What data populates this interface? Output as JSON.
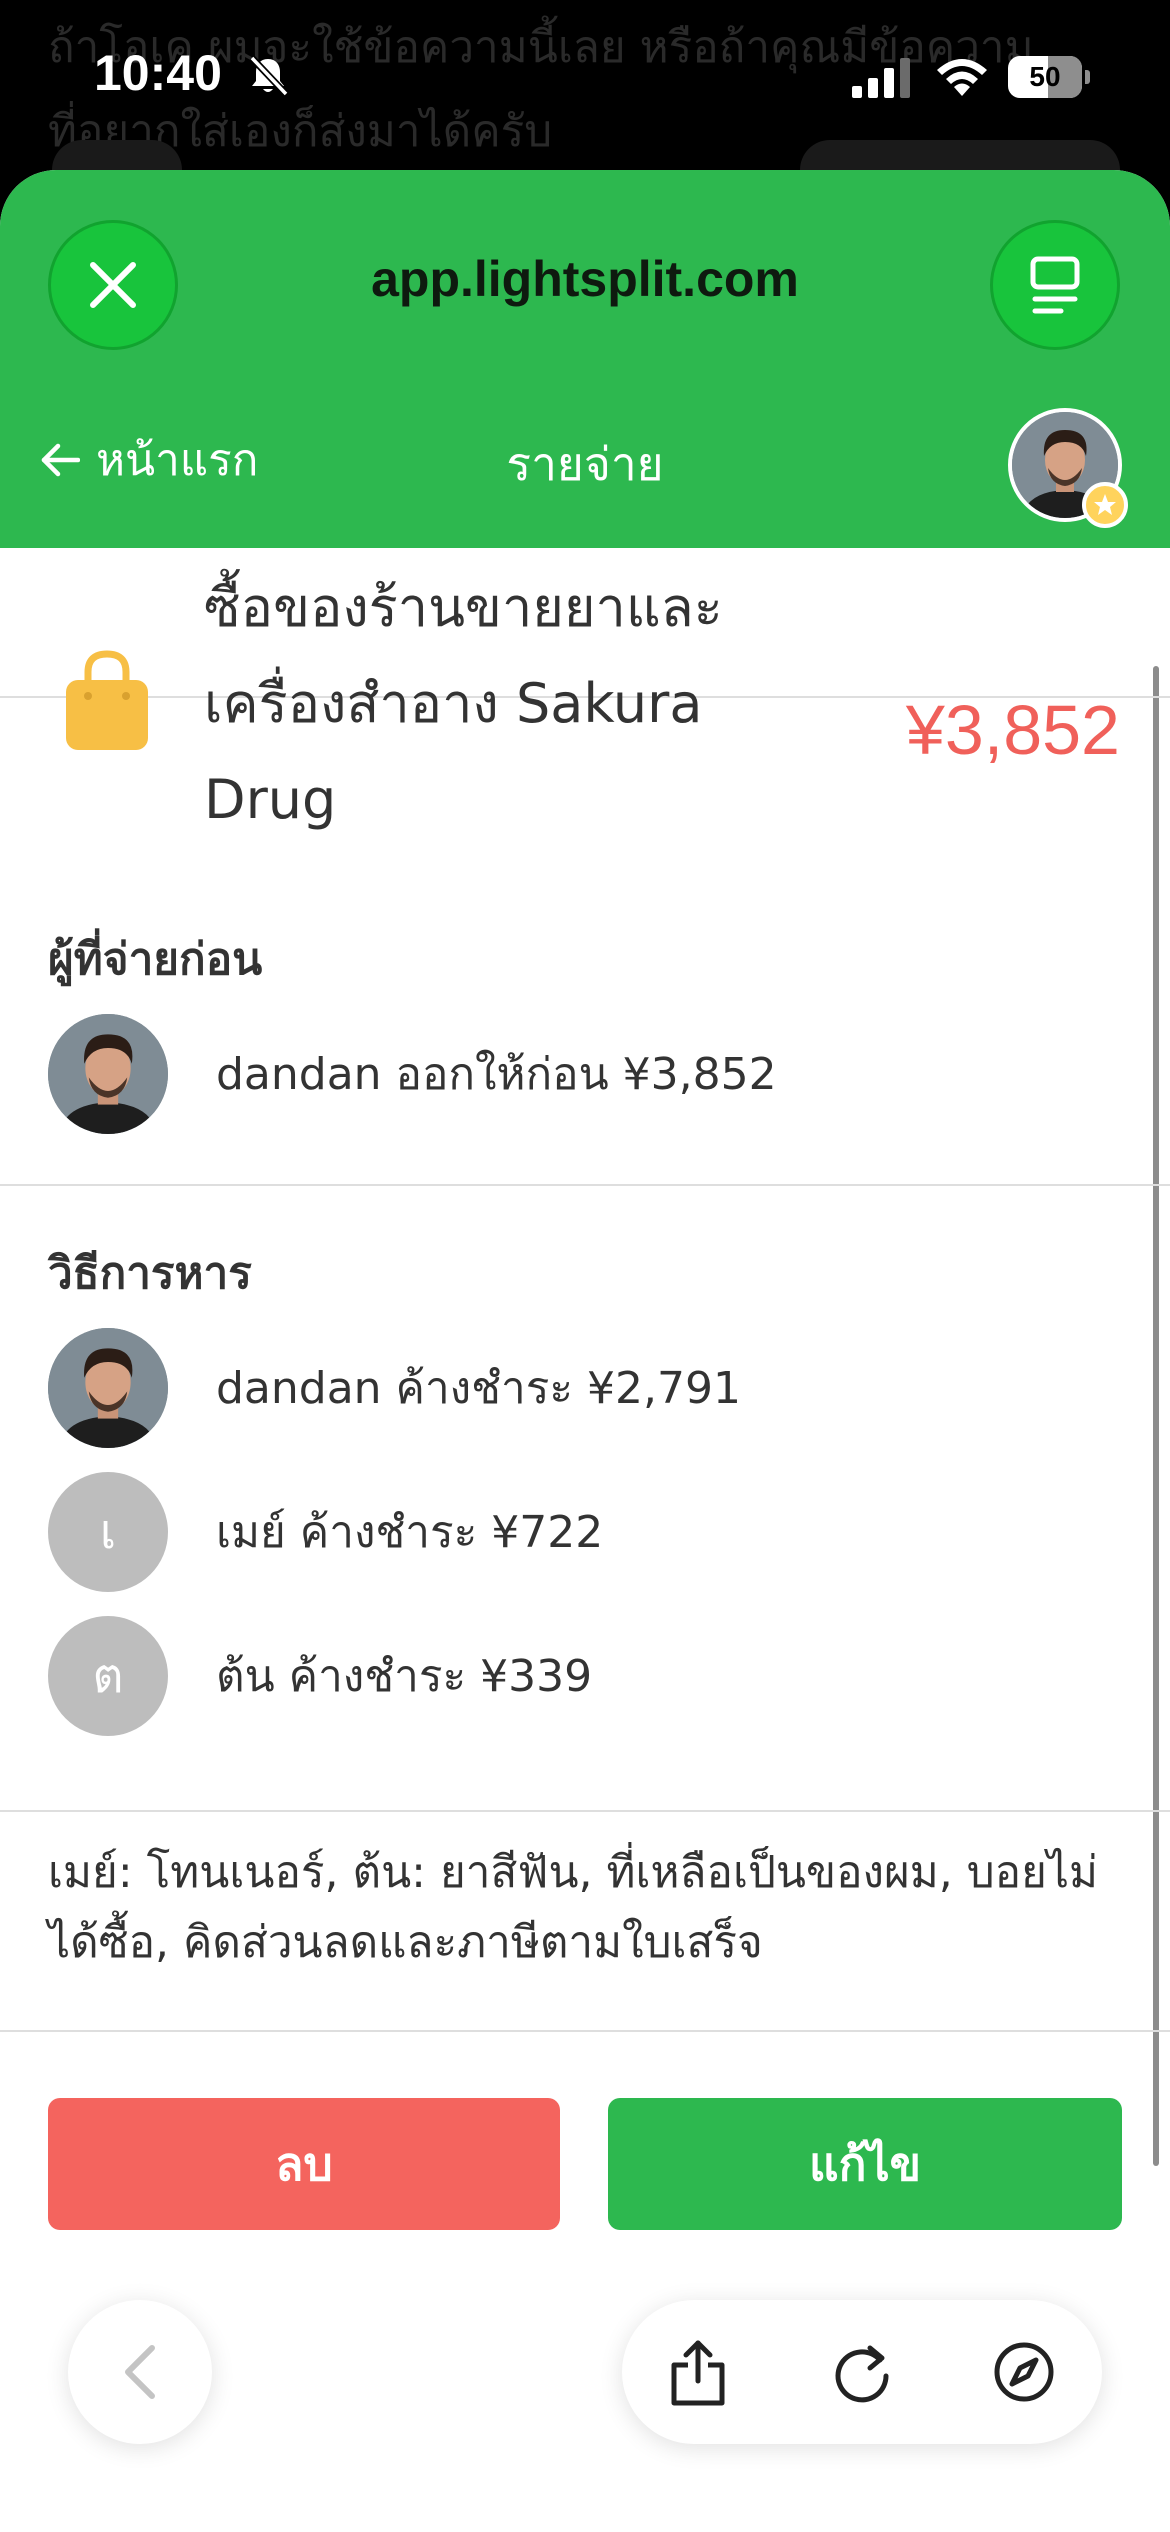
{
  "background_chat": {
    "line1": "ถ้าโอเค ผมจะใช้ข้อความนี้เลย หรือถ้าคุณมีข้อความ",
    "line2": "ที่อยากใส่เองก็ส่งมาได้ครับ"
  },
  "status_bar": {
    "time": "10:40",
    "battery": "50",
    "icons": [
      "bell-slash-icon",
      "cellular-signal-icon",
      "wifi-icon",
      "battery-icon"
    ]
  },
  "browser": {
    "url": "app.lightsplit.com",
    "close_icon": "close-icon",
    "menu_icon": "tab-menu-icon"
  },
  "nav": {
    "back_label": "หน้าแรก",
    "title": "รายจ่าย"
  },
  "expense": {
    "icon": "shopping-bag-icon",
    "title_lines": [
      "ซื้อของร้านขายยาและ",
      "เครื่องสำอาง Sakura",
      "Drug"
    ],
    "amount": "¥3,852",
    "amount_color": "#f0605a"
  },
  "paid_by": {
    "title": "ผู้ที่จ่ายก่อน",
    "rows": [
      {
        "text": "dandan ออกให้ก่อน ¥3,852"
      }
    ]
  },
  "split": {
    "title": "วิธีการหาร",
    "rows": [
      {
        "initial": "",
        "text": "dandan ค้างชำระ ¥2,791"
      },
      {
        "initial": "เ",
        "text": "เมย์ ค้างชำระ ¥722"
      },
      {
        "initial": "ต",
        "text": "ต้น ค้างชำระ ¥339"
      }
    ]
  },
  "note": {
    "line1": "เมย์: โทนเนอร์, ต้น: ยาสีฟัน, ที่เหลือเป็นของผม, บอยไม่",
    "line2": "ได้ซื้อ, คิดส่วนลดและภาษีตามใบเสร็จ"
  },
  "actions": {
    "delete_label": "ลบ",
    "edit_label": "แก้ไข",
    "delete_color": "#f4645e",
    "edit_color": "#2db84f"
  },
  "toolbar": {
    "icons": [
      "back-chevron-icon",
      "share-icon",
      "reload-icon",
      "compass-icon"
    ]
  },
  "colors": {
    "brand_green": "#2db84f"
  }
}
